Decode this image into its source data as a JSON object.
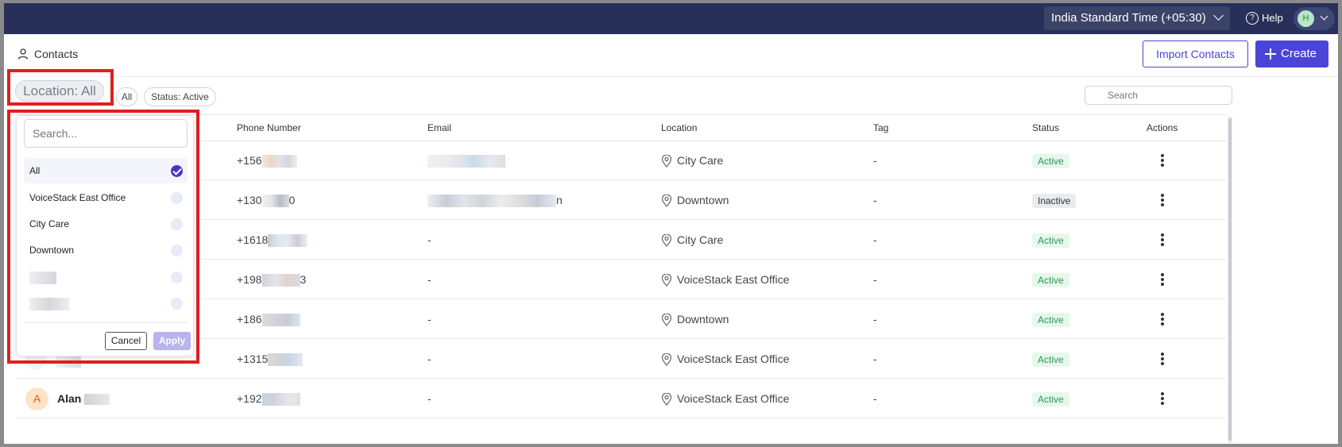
{
  "topbar": {
    "timezone": "India Standard Time (+05:30)",
    "help_label": "Help",
    "user_initial": "H"
  },
  "header": {
    "title": "Contacts",
    "import_label": "Import Contacts",
    "create_label": "Create"
  },
  "filters": {
    "location_chip": "Location: All",
    "tag_chip": "All",
    "status_chip": "Status: Active",
    "search_placeholder": "Search"
  },
  "table": {
    "columns": {
      "phone": "Phone Number",
      "email": "Email",
      "location": "Location",
      "tag": "Tag",
      "status": "Status",
      "actions": "Actions"
    },
    "rows": [
      {
        "phone": "+156",
        "email_suffix": "",
        "email": "",
        "location": "City Care",
        "tag": "-",
        "status": "Active",
        "status_kind": "active"
      },
      {
        "phone": "+130",
        "phone_suffix": "0",
        "email": "",
        "email_suffix": "n",
        "location": "Downtown",
        "tag": "-",
        "status": "Inactive",
        "status_kind": "inactive"
      },
      {
        "phone": "+1618",
        "email": "-",
        "location": "City Care",
        "tag": "-",
        "status": "Active",
        "status_kind": "active"
      },
      {
        "phone": "+198",
        "phone_suffix": "3",
        "email": "-",
        "location": "VoiceStack East Office",
        "tag": "-",
        "status": "Active",
        "status_kind": "active"
      },
      {
        "phone": "+186",
        "email": "-",
        "location": "Downtown",
        "tag": "-",
        "status": "Active",
        "status_kind": "active"
      },
      {
        "phone": "+1315",
        "email": "-",
        "location": "VoiceStack East Office",
        "tag": "-",
        "status": "Active",
        "status_kind": "active"
      },
      {
        "name_initial": "A",
        "name": "Alan",
        "phone": "+192",
        "email": "-",
        "location": "VoiceStack East Office",
        "tag": "-",
        "status": "Active",
        "status_kind": "active"
      }
    ]
  },
  "location_dropdown": {
    "search_placeholder": "Search...",
    "options": [
      {
        "label": "All",
        "checked": true
      },
      {
        "label": "VoiceStack East Office",
        "checked": false
      },
      {
        "label": "City Care",
        "checked": false
      },
      {
        "label": "Downtown",
        "checked": false
      },
      {
        "label": "",
        "checked": false
      },
      {
        "label": "",
        "checked": false
      }
    ],
    "cancel_label": "Cancel",
    "apply_label": "Apply"
  },
  "colors": {
    "nav_bg": "#28305a",
    "primary": "#4b44d8",
    "highlight": "#e01e1e",
    "active_green": "#249a52"
  }
}
